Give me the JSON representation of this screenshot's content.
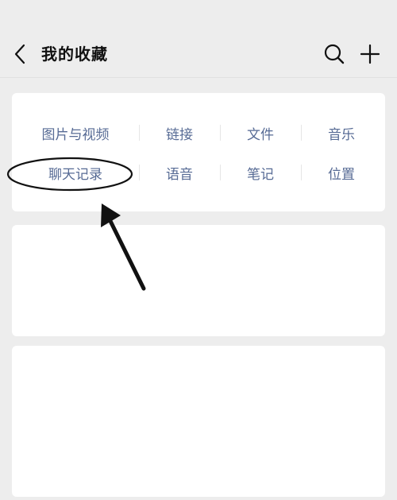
{
  "header": {
    "title": "我的收藏"
  },
  "categories": {
    "row1": [
      "图片与视频",
      "链接",
      "文件",
      "音乐"
    ],
    "row2": [
      "聊天记录",
      "语音",
      "笔记",
      "位置"
    ]
  },
  "colors": {
    "link": "#576b95",
    "background": "#ededed",
    "card": "#ffffff"
  }
}
